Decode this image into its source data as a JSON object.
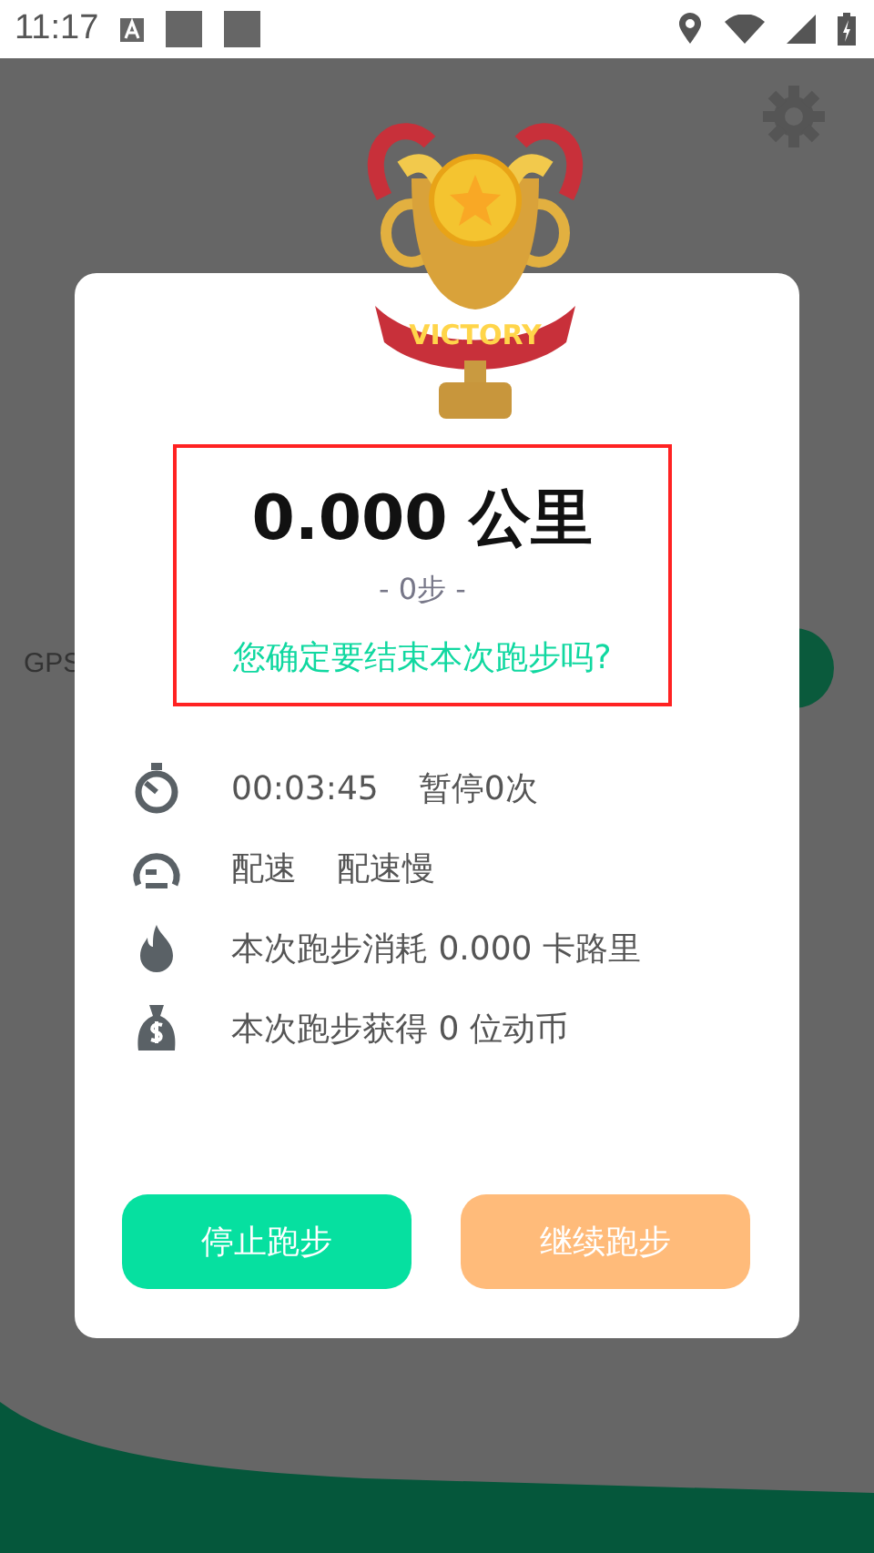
{
  "status_bar": {
    "time": "11:17"
  },
  "background": {
    "gps_label": "GPS"
  },
  "dialog": {
    "trophy_banner": "VICTORY",
    "distance": "0.000 公里",
    "steps": "- 0步 -",
    "question": "您确定要结束本次跑步吗?",
    "stats": [
      {
        "kind": "timer",
        "texts": [
          "00:03:45",
          "暂停0次"
        ]
      },
      {
        "kind": "pace",
        "texts": [
          "配速",
          "配速慢"
        ]
      },
      {
        "kind": "flame",
        "texts": [
          "本次跑步消耗 0.000 卡路里"
        ]
      },
      {
        "kind": "money",
        "texts": [
          "本次跑步获得 0 位动币"
        ]
      }
    ],
    "buttons": [
      {
        "kind": "stop",
        "label": "停止跑步"
      },
      {
        "kind": "continue",
        "label": "继续跑步"
      }
    ]
  }
}
